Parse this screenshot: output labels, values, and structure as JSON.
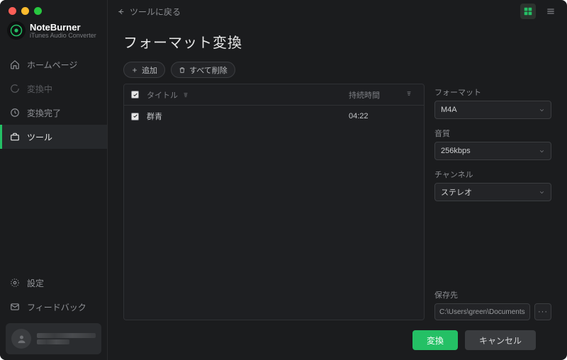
{
  "brand": {
    "name": "NoteBurner",
    "subtitle": "iTunes Audio Converter"
  },
  "sidebar": {
    "items": [
      {
        "label": "ホームページ",
        "icon": "home-icon"
      },
      {
        "label": "変換中",
        "icon": "spinner-icon",
        "dim": true
      },
      {
        "label": "変換完了",
        "icon": "clock-icon"
      },
      {
        "label": "ツール",
        "icon": "toolbox-icon",
        "active": true
      }
    ],
    "settings_label": "設定",
    "feedback_label": "フィードバック"
  },
  "topbar": {
    "back_label": "ツールに戻る"
  },
  "page": {
    "title": "フォーマット変換"
  },
  "toolbar": {
    "add_label": "追加",
    "delete_all_label": "すべて削除"
  },
  "table": {
    "header_title": "タイトル",
    "header_duration": "持続時間",
    "rows": [
      {
        "title": "群青",
        "duration": "04:22",
        "checked": true
      }
    ]
  },
  "panel": {
    "format": {
      "label": "フォーマット",
      "value": "M4A"
    },
    "bitrate": {
      "label": "音質",
      "value": "256kbps"
    },
    "channel": {
      "label": "チャンネル",
      "value": "ステレオ"
    },
    "save_to": {
      "label": "保存先",
      "value": "C:\\Users\\green\\Documents"
    }
  },
  "footer": {
    "convert_label": "変換",
    "cancel_label": "キャンセル"
  }
}
